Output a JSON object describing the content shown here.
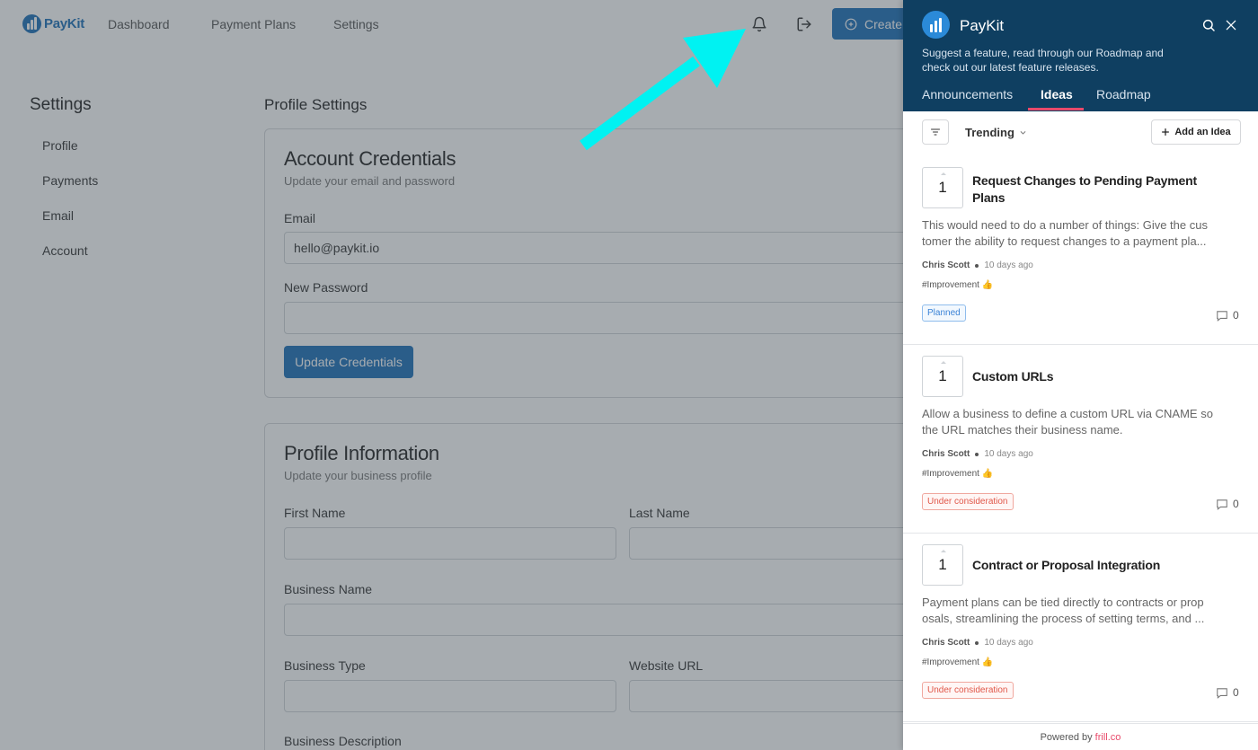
{
  "app": {
    "logo_text": "PayKit",
    "nav": [
      "Dashboard",
      "Payment Plans",
      "Settings"
    ],
    "create_label": "Create",
    "icons": {
      "notifications": "bell-icon",
      "logout": "logout-icon",
      "create": "plus-circle-icon"
    }
  },
  "settings": {
    "title": "Settings",
    "items": [
      "Profile",
      "Payments",
      "Email",
      "Account"
    ]
  },
  "profile_settings": {
    "title": "Profile Settings",
    "credentials": {
      "title": "Account Credentials",
      "subtitle": "Update your email and password",
      "email_label": "Email",
      "email_value": "hello@paykit.io",
      "password_label": "New Password",
      "password_value": "",
      "button": "Update Credentials"
    },
    "profile": {
      "title": "Profile Information",
      "subtitle": "Update your business profile",
      "first_name_label": "First Name",
      "last_name_label": "Last Name",
      "business_name_label": "Business Name",
      "business_type_label": "Business Type",
      "website_label": "Website URL",
      "description_label": "Business Description"
    }
  },
  "widget": {
    "title": "PayKit",
    "description": "Suggest a feature, read through our Roadmap and check out our latest feature releases.",
    "tabs": [
      "Announcements",
      "Ideas",
      "Roadmap"
    ],
    "active_tab": "Ideas",
    "sort_label": "Trending",
    "add_idea_label": "Add an Idea",
    "accent_color": "#e8496a",
    "header_color": "#0f3f61",
    "ideas": [
      {
        "votes": "1",
        "title": "Request Changes to Pending Payment Plans",
        "description": "This would need to do a number of things: Give the cus tomer the ability to request changes to a payment pla...",
        "author": "Chris Scott",
        "time": "10 days ago",
        "tag": "#Improvement 👍",
        "status": "Planned",
        "comments": "0"
      },
      {
        "votes": "1",
        "title": "Custom URLs",
        "description": "Allow a business to define a custom URL via CNAME so the URL matches their business name.",
        "author": "Chris Scott",
        "time": "10 days ago",
        "tag": "#Improvement 👍",
        "status": "Under consideration",
        "comments": "0"
      },
      {
        "votes": "1",
        "title": "Contract or Proposal Integration",
        "description": "Payment plans can be tied directly to contracts or prop osals, streamlining the process of setting terms, and ...",
        "author": "Chris Scott",
        "time": "10 days ago",
        "tag": "#Improvement 👍",
        "status": "Under consideration",
        "comments": "0"
      }
    ],
    "powered_prefix": "Powered by",
    "powered_brand": "frill.co"
  }
}
